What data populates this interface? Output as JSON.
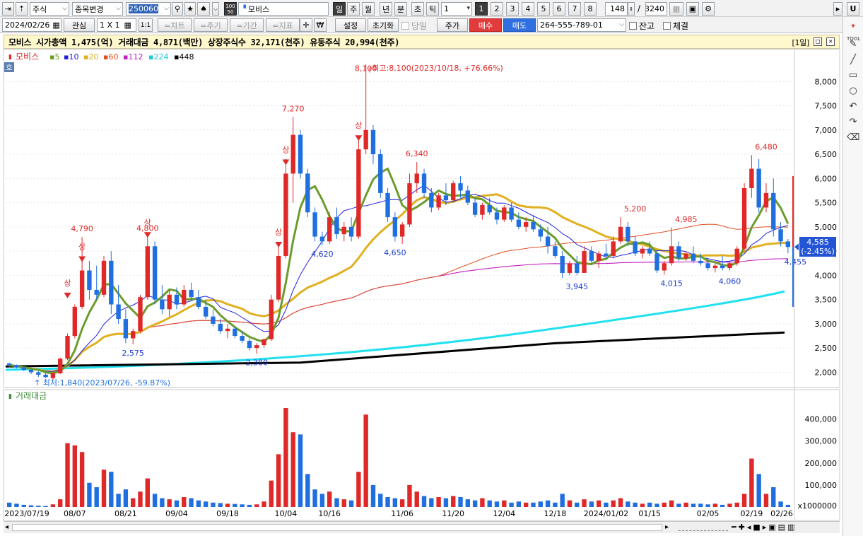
{
  "toolbar1": {
    "market": "주식",
    "change_label": "종목변경",
    "code": "250060",
    "stock_name": "모비스",
    "badge_top": "100",
    "badge_bottom": "50",
    "periods": [
      "일",
      "주",
      "월",
      "년",
      "분",
      "초",
      "틱"
    ],
    "interval_value": "1",
    "num_buttons": [
      "1",
      "2",
      "3",
      "4",
      "5",
      "6",
      "7",
      "8"
    ],
    "count": "148",
    "separator": "/",
    "total": "3240",
    "right_btn": "U"
  },
  "toolbar2": {
    "date": "2024/02/26",
    "interest_label": "관심",
    "grid_label": "1 X 1",
    "one_to_one": "1:1",
    "chart_label": "=차트",
    "cycle_label": "=주기",
    "range_label": "=기간",
    "index_label": "=지표",
    "won_label": "₩",
    "settings_label": "설정",
    "reset_label": "초기화",
    "sameday_label": "당일",
    "price_label": "주가",
    "buy_label": "매수",
    "sell_label": "매도",
    "account": "264-555-789-01",
    "balance_label": "잔고",
    "fill_label": "체결"
  },
  "info": {
    "text": "모비스  시가총액 1,475(억)  거래대금 4,871(백만)  상장주식수 32,171(천주)  유동주식 20,994(천주)",
    "period_label": "[1일]"
  },
  "legend": {
    "name": "모비스",
    "mas": [
      "5",
      "10",
      "20",
      "60",
      "112",
      "224",
      "448"
    ],
    "ma_colors": [
      "#6b9c2c",
      "#2020e0",
      "#e0b020",
      "#e05020",
      "#c020c0",
      "#20e0f0",
      "#000000"
    ],
    "ho_label": "호"
  },
  "annotations": {
    "high_text": "최고:8,100(2023/10/18, +76.66%)",
    "low_text": "최저:1,840(2023/07/26, -59.87%)",
    "sang": "상",
    "red_labels": [
      "4,790",
      "4,800",
      "7,270",
      "8,100",
      "6,340",
      "5,200",
      "4,985",
      "6,480"
    ],
    "blue_labels": [
      "2,575",
      "2,380",
      "4,620",
      "4,650",
      "3,945",
      "4,015",
      "4,060",
      "4,455"
    ]
  },
  "price_axis": [
    "8,000",
    "7,500",
    "7,000",
    "6,500",
    "6,000",
    "5,500",
    "5,000",
    "4,500",
    "4,000",
    "3,500",
    "3,000",
    "2,500",
    "2,000"
  ],
  "current_price": {
    "value": "4,585",
    "change": "(-2.45%)",
    "color": "#2254d4"
  },
  "volume_panel": {
    "title": "거래대금",
    "axis": [
      "400,000",
      "300,000",
      "200,000",
      "100,000"
    ],
    "unit": "x1000000"
  },
  "date_axis": [
    "2023/07/19",
    "08/07",
    "08/21",
    "09/04",
    "09/18",
    "10/04",
    "10/16",
    "11/06",
    "11/20",
    "12/04",
    "12/18",
    "2024/01/02",
    "01/15",
    "02/05",
    "02/19",
    "02/26"
  ],
  "colors": {
    "up": "#e02828",
    "down": "#1f6fe0",
    "bg": "#ffffff",
    "grid": "#e6e6e6"
  },
  "right_tools": [
    "TOOL",
    "line-icon",
    "rect-icon",
    "circle-icon",
    "undo-icon",
    "redo-icon",
    "eraser-icon"
  ],
  "chart_data": {
    "type": "candlestick",
    "candles": [
      [
        2180,
        2200,
        2100,
        2150
      ],
      [
        2150,
        2160,
        2080,
        2100
      ],
      [
        2100,
        2120,
        2030,
        2050
      ],
      [
        2050,
        2070,
        1960,
        2000
      ],
      [
        2000,
        2020,
        1900,
        1950
      ],
      [
        1950,
        2000,
        1880,
        1900
      ],
      [
        1880,
        2000,
        1840,
        1980
      ],
      [
        1980,
        2300,
        1960,
        2280
      ],
      [
        2280,
        2800,
        2250,
        2750
      ],
      [
        2750,
        3400,
        2700,
        3350
      ],
      [
        3350,
        4790,
        3300,
        4100
      ],
      [
        4100,
        4300,
        3500,
        3700
      ],
      [
        3700,
        4200,
        3500,
        3600
      ],
      [
        3600,
        4400,
        3550,
        4300
      ],
      [
        4300,
        4500,
        3200,
        3400
      ],
      [
        3400,
        3800,
        3000,
        3100
      ],
      [
        3100,
        3300,
        2600,
        2700
      ],
      [
        2700,
        2900,
        2575,
        2850
      ],
      [
        2850,
        3600,
        2800,
        3550
      ],
      [
        3550,
        4800,
        3500,
        4600
      ],
      [
        4600,
        4700,
        3400,
        3500
      ],
      [
        3500,
        3800,
        3200,
        3300
      ],
      [
        3300,
        3700,
        3150,
        3600
      ],
      [
        3600,
        3750,
        3300,
        3400
      ],
      [
        3400,
        3800,
        3350,
        3700
      ],
      [
        3700,
        3850,
        3500,
        3550
      ],
      [
        3550,
        3700,
        3300,
        3350
      ],
      [
        3350,
        3500,
        3100,
        3150
      ],
      [
        3150,
        3300,
        2950,
        3000
      ],
      [
        3000,
        3100,
        2800,
        2850
      ],
      [
        2850,
        3000,
        2700,
        2900
      ],
      [
        2900,
        2950,
        2700,
        2750
      ],
      [
        2750,
        2850,
        2600,
        2650
      ],
      [
        2650,
        2700,
        2450,
        2500
      ],
      [
        2500,
        2600,
        2380,
        2560
      ],
      [
        2560,
        2700,
        2500,
        2680
      ],
      [
        2680,
        3600,
        2650,
        3500
      ],
      [
        3500,
        4600,
        3450,
        4400
      ],
      [
        4400,
        6400,
        4350,
        6100
      ],
      [
        6100,
        7270,
        5500,
        6900
      ],
      [
        6900,
        7000,
        6000,
        6100
      ],
      [
        6100,
        6200,
        5200,
        5300
      ],
      [
        5300,
        5400,
        4700,
        4800
      ],
      [
        4800,
        4900,
        4620,
        4700
      ],
      [
        4700,
        5300,
        4650,
        5200
      ],
      [
        5200,
        5400,
        4750,
        4850
      ],
      [
        4850,
        5100,
        4700,
        5000
      ],
      [
        5000,
        5200,
        4700,
        4800
      ],
      [
        4800,
        6800,
        4750,
        6600
      ],
      [
        6600,
        8100,
        6500,
        7000
      ],
      [
        7000,
        7100,
        6300,
        6500
      ],
      [
        6500,
        6600,
        5600,
        5700
      ],
      [
        5700,
        5800,
        5100,
        5200
      ],
      [
        5200,
        5300,
        4700,
        4800
      ],
      [
        4800,
        5100,
        4650,
        5050
      ],
      [
        5050,
        6100,
        5000,
        5900
      ],
      [
        5900,
        6340,
        5700,
        6100
      ],
      [
        6100,
        6200,
        5600,
        5700
      ],
      [
        5700,
        5800,
        5300,
        5400
      ],
      [
        5400,
        5700,
        5350,
        5650
      ],
      [
        5650,
        5900,
        5450,
        5550
      ],
      [
        5550,
        5950,
        5500,
        5900
      ],
      [
        5900,
        6050,
        5600,
        5750
      ],
      [
        5750,
        5850,
        5450,
        5500
      ],
      [
        5500,
        5600,
        5200,
        5250
      ],
      [
        5250,
        5500,
        5150,
        5450
      ],
      [
        5450,
        5600,
        5250,
        5300
      ],
      [
        5300,
        5400,
        5050,
        5150
      ],
      [
        5150,
        5450,
        5100,
        5400
      ],
      [
        5400,
        5500,
        5100,
        5150
      ],
      [
        5150,
        5300,
        4950,
        5000
      ],
      [
        5000,
        5200,
        4900,
        5100
      ],
      [
        5100,
        5250,
        4900,
        4950
      ],
      [
        4950,
        5050,
        4700,
        4800
      ],
      [
        4800,
        5000,
        4450,
        4600
      ],
      [
        4600,
        4700,
        4350,
        4400
      ],
      [
        4400,
        4500,
        3945,
        4050
      ],
      [
        4050,
        4300,
        4000,
        4250
      ],
      [
        4250,
        4400,
        4000,
        4050
      ],
      [
        4050,
        4600,
        4050,
        4500
      ],
      [
        4500,
        4600,
        4250,
        4300
      ],
      [
        4300,
        4500,
        4150,
        4450
      ],
      [
        4450,
        4650,
        4350,
        4400
      ],
      [
        4400,
        4800,
        4350,
        4700
      ],
      [
        4700,
        5200,
        4650,
        5000
      ],
      [
        5000,
        5100,
        4600,
        4700
      ],
      [
        4700,
        4800,
        4400,
        4450
      ],
      [
        4450,
        4600,
        4350,
        4550
      ],
      [
        4550,
        4700,
        4400,
        4450
      ],
      [
        4450,
        4500,
        4050,
        4100
      ],
      [
        4100,
        4300,
        4015,
        4250
      ],
      [
        4250,
        4985,
        4200,
        4600
      ],
      [
        4600,
        4700,
        4300,
        4350
      ],
      [
        4350,
        4500,
        4300,
        4450
      ],
      [
        4450,
        4600,
        4250,
        4300
      ],
      [
        4300,
        4450,
        4200,
        4250
      ],
      [
        4250,
        4350,
        4100,
        4150
      ],
      [
        4150,
        4250,
        4060,
        4200
      ],
      [
        4200,
        4400,
        4100,
        4150
      ],
      [
        4150,
        4300,
        4100,
        4250
      ],
      [
        4250,
        4600,
        4200,
        4550
      ],
      [
        4550,
        5900,
        4500,
        5800
      ],
      [
        5800,
        6480,
        5600,
        6200
      ],
      [
        6200,
        6400,
        5300,
        5400
      ],
      [
        5400,
        5900,
        5300,
        5700
      ],
      [
        5700,
        6000,
        4800,
        4950
      ],
      [
        4950,
        5100,
        4600,
        4700
      ],
      [
        4700,
        4750,
        4455,
        4585
      ]
    ],
    "volume": [
      20,
      15,
      10,
      8,
      6,
      5,
      12,
      35,
      290,
      280,
      250,
      110,
      90,
      170,
      160,
      60,
      80,
      40,
      70,
      130,
      60,
      40,
      35,
      30,
      45,
      40,
      30,
      25,
      20,
      18,
      15,
      14,
      12,
      10,
      12,
      25,
      120,
      240,
      450,
      340,
      330,
      150,
      80,
      60,
      70,
      40,
      35,
      30,
      160,
      420,
      100,
      60,
      45,
      40,
      35,
      100,
      70,
      50,
      40,
      45,
      40,
      50,
      45,
      35,
      30,
      40,
      30,
      25,
      30,
      20,
      25,
      20,
      20,
      25,
      30,
      20,
      60,
      30,
      20,
      35,
      25,
      30,
      20,
      30,
      40,
      25,
      20,
      15,
      20,
      15,
      20,
      30,
      15,
      20,
      15,
      15,
      12,
      15,
      10,
      15,
      20,
      60,
      220,
      150,
      60,
      90,
      25,
      10
    ],
    "price_axis_range": [
      1700,
      8500
    ],
    "volume_axis_range": [
      0,
      450000
    ]
  }
}
